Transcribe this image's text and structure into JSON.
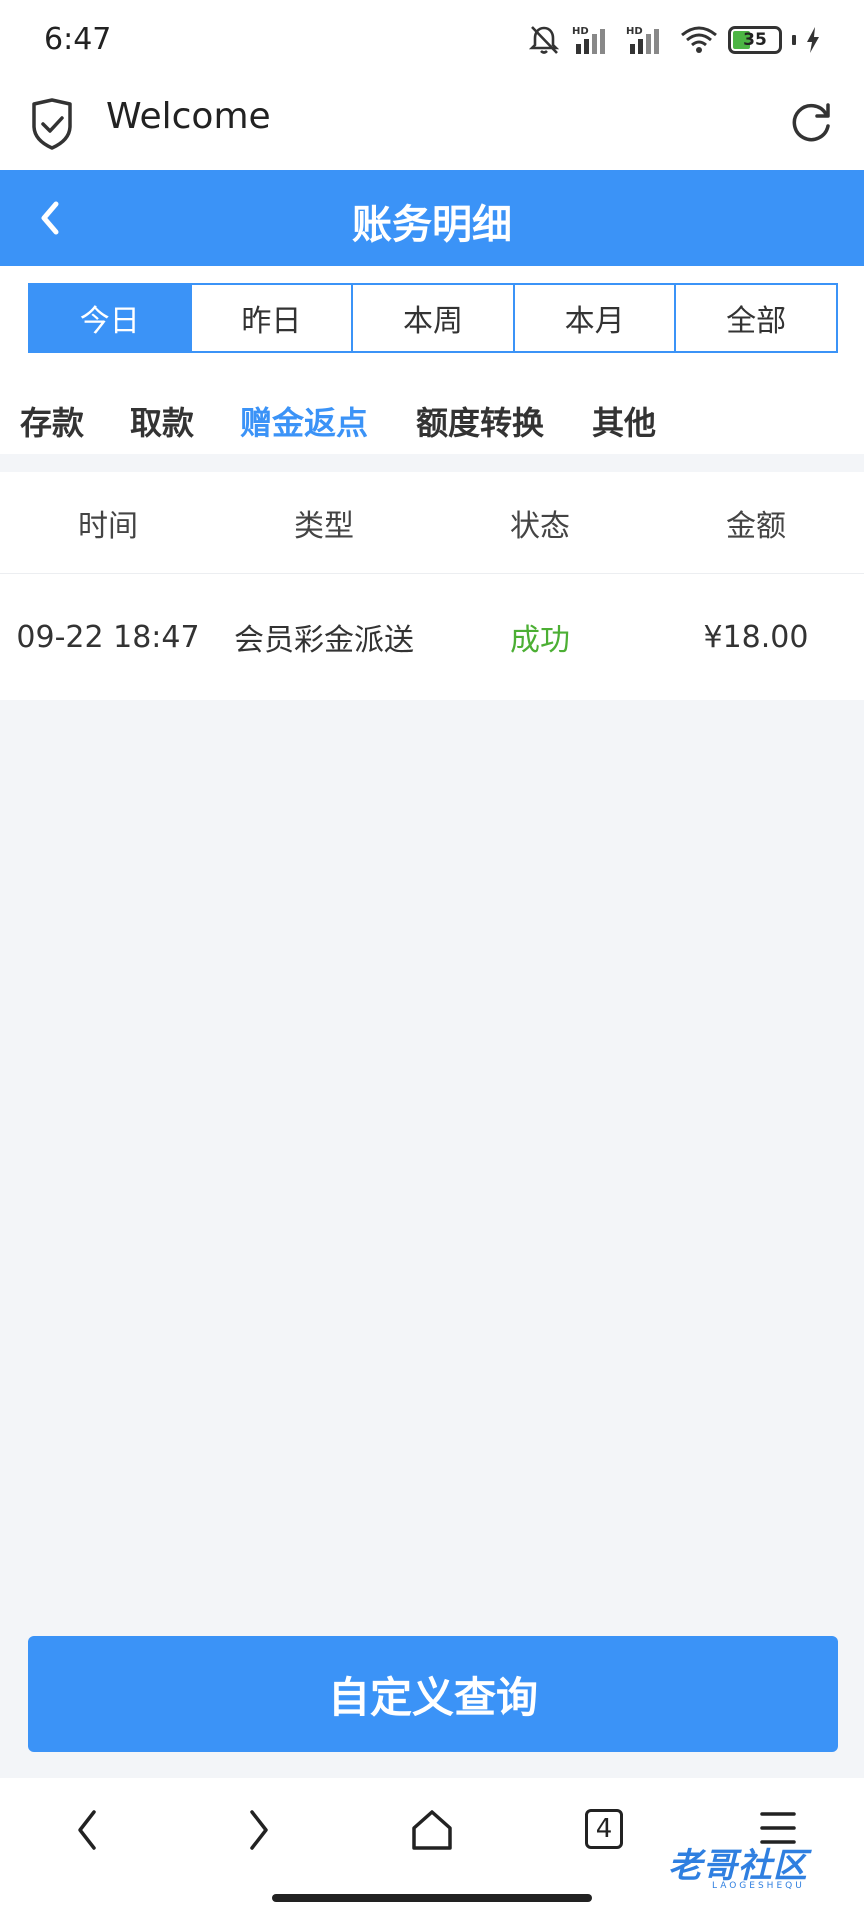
{
  "status_bar": {
    "time": "6:47",
    "battery": "35"
  },
  "browser": {
    "title": "Welcome"
  },
  "header": {
    "title": "账务明细"
  },
  "date_tabs": [
    {
      "label": "今日",
      "active": true
    },
    {
      "label": "昨日",
      "active": false
    },
    {
      "label": "本周",
      "active": false
    },
    {
      "label": "本月",
      "active": false
    },
    {
      "label": "全部",
      "active": false
    }
  ],
  "category_tabs": [
    {
      "label": "存款",
      "active": false
    },
    {
      "label": "取款",
      "active": false
    },
    {
      "label": "赠金返点",
      "active": true
    },
    {
      "label": "额度转换",
      "active": false
    },
    {
      "label": "其他",
      "active": false
    }
  ],
  "table": {
    "headers": [
      "时间",
      "类型",
      "状态",
      "金额"
    ],
    "rows": [
      {
        "time": "09-22 18:47",
        "type": "会员彩金派送",
        "status": "成功",
        "amount": "¥18.00"
      }
    ]
  },
  "query_button": {
    "label": "自定义查询"
  },
  "bottom_nav": {
    "tab_count": "4"
  },
  "watermark": {
    "text": "老哥社区",
    "sub": "LAOGESHEQU"
  },
  "colors": {
    "primary": "#3b93f7",
    "success": "#4caf34"
  }
}
